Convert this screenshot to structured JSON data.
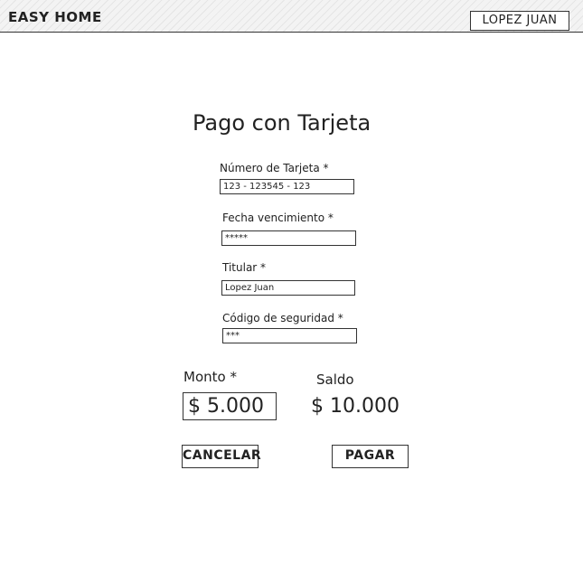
{
  "header": {
    "brand": "EASY HOME",
    "user": "LOPEZ JUAN"
  },
  "form": {
    "title": "Pago con Tarjeta",
    "card_number": {
      "label": "Número de Tarjeta *",
      "value": "123 - 123545 - 123"
    },
    "expiry": {
      "label": "Fecha vencimiento *",
      "value": "*****"
    },
    "holder": {
      "label": "Titular *",
      "value": "Lopez Juan"
    },
    "security_code": {
      "label": "Código de seguridad *",
      "value": "***"
    }
  },
  "amounts": {
    "monto_label": "Monto *",
    "monto_value": "$ 5.000",
    "saldo_label": "Saldo",
    "saldo_value": "$ 10.000"
  },
  "actions": {
    "cancel": "CANCELAR",
    "pay": "PAGAR"
  }
}
